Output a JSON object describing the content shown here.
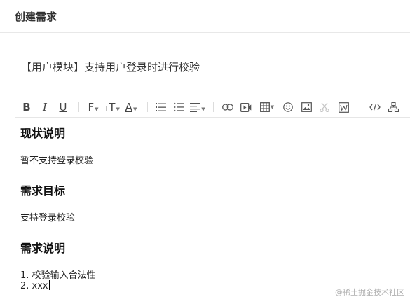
{
  "header": {
    "title": "创建需求"
  },
  "requirement": {
    "title": "【用户模块】支持用户登录时进行校验"
  },
  "toolbar": {
    "bold": "B",
    "italic": "I",
    "underline": "U",
    "font_family": "F",
    "font_size": "T",
    "font_color": "A"
  },
  "editor": {
    "section1": {
      "heading": "现状说明",
      "text": "暂不支持登录校验"
    },
    "section2": {
      "heading": "需求目标",
      "text": "支持登录校验"
    },
    "section3": {
      "heading": "需求说明",
      "items": [
        "1. 校验输入合法性",
        "2. xxx"
      ]
    }
  },
  "watermark": "@稀土掘金技术社区"
}
